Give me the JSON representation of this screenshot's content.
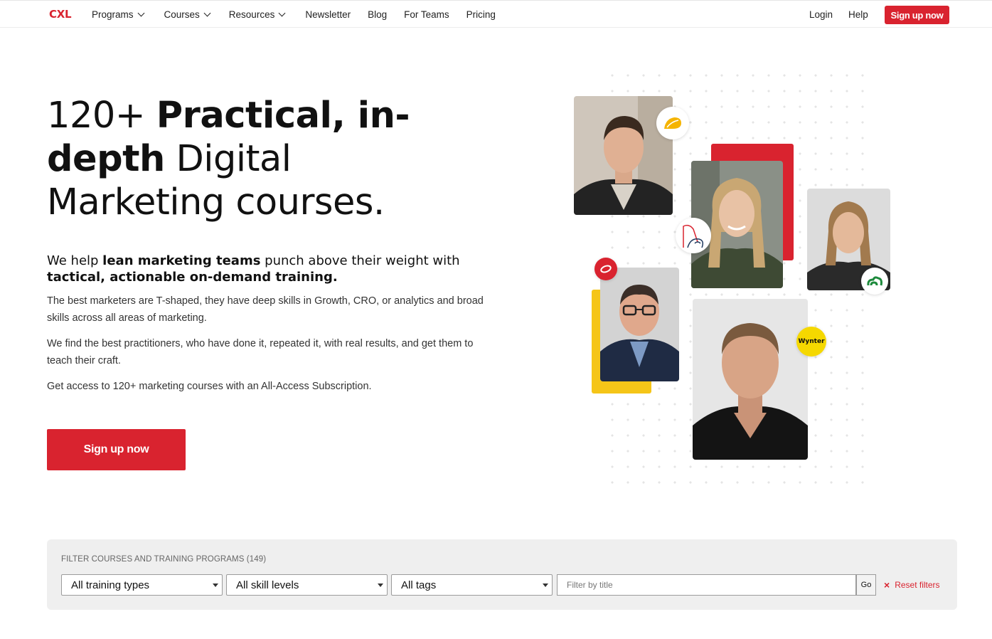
{
  "header": {
    "logo": "CXL",
    "nav": [
      {
        "label": "Programs",
        "dropdown": true
      },
      {
        "label": "Courses",
        "dropdown": true
      },
      {
        "label": "Resources",
        "dropdown": true
      },
      {
        "label": "Newsletter",
        "dropdown": false
      },
      {
        "label": "Blog",
        "dropdown": false
      },
      {
        "label": "For Teams",
        "dropdown": false
      },
      {
        "label": "Pricing",
        "dropdown": false
      }
    ],
    "login": "Login",
    "help": "Help",
    "signup": "Sign up now"
  },
  "hero": {
    "headline": {
      "part1": "120+ ",
      "bold1": "Practical, in-depth",
      "part2": " Digital Marketing courses."
    },
    "lead": {
      "part1": "We help ",
      "bold1": "lean marketing teams",
      "part2": " punch above their weight with ",
      "bold2": "tactical, actionable on-demand training."
    },
    "paragraphs": [
      "The best marketers are T-shaped, they have deep skills in Growth, CRO, or analytics and broad skills across all areas of marketing.",
      "We find the best practitioners, who have done it, repeated it, with real results, and get them to teach their craft.",
      "Get access to 120+ marketing courses with an All-Access Subscription."
    ],
    "cta": "Sign up now"
  },
  "collage": {
    "wynter_badge": "Wynter"
  },
  "filter": {
    "title": "FILTER COURSES AND TRAINING PROGRAMS (149)",
    "training_type": "All training types",
    "skill_level": "All skill levels",
    "tags": "All tags",
    "title_placeholder": "Filter by title",
    "go": "Go",
    "reset": "Reset filters"
  },
  "colors": {
    "brand": "#d9232f",
    "accent_yellow": "#f5c518"
  }
}
